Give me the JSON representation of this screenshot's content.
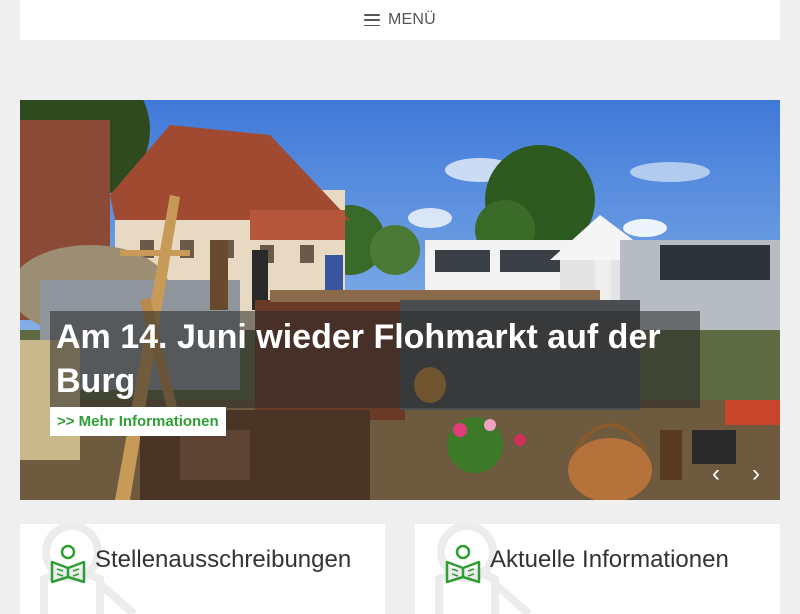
{
  "header": {
    "menu_label": "MENÜ",
    "menu_icon": "hamburger-icon"
  },
  "hero": {
    "title": "Am 14. Juni wieder Flohmarkt auf der Burg",
    "link_label": ">> Mehr Informationen",
    "prev_arrow": "‹",
    "next_arrow": "›"
  },
  "cards": [
    {
      "title": "Stellenausschreibungen",
      "icon": "open-book-reader-icon"
    },
    {
      "title": "Aktuelle Informationen",
      "icon": "open-book-reader-icon"
    }
  ],
  "colors": {
    "accent_green": "#2f9e35",
    "page_background": "#efefef"
  }
}
